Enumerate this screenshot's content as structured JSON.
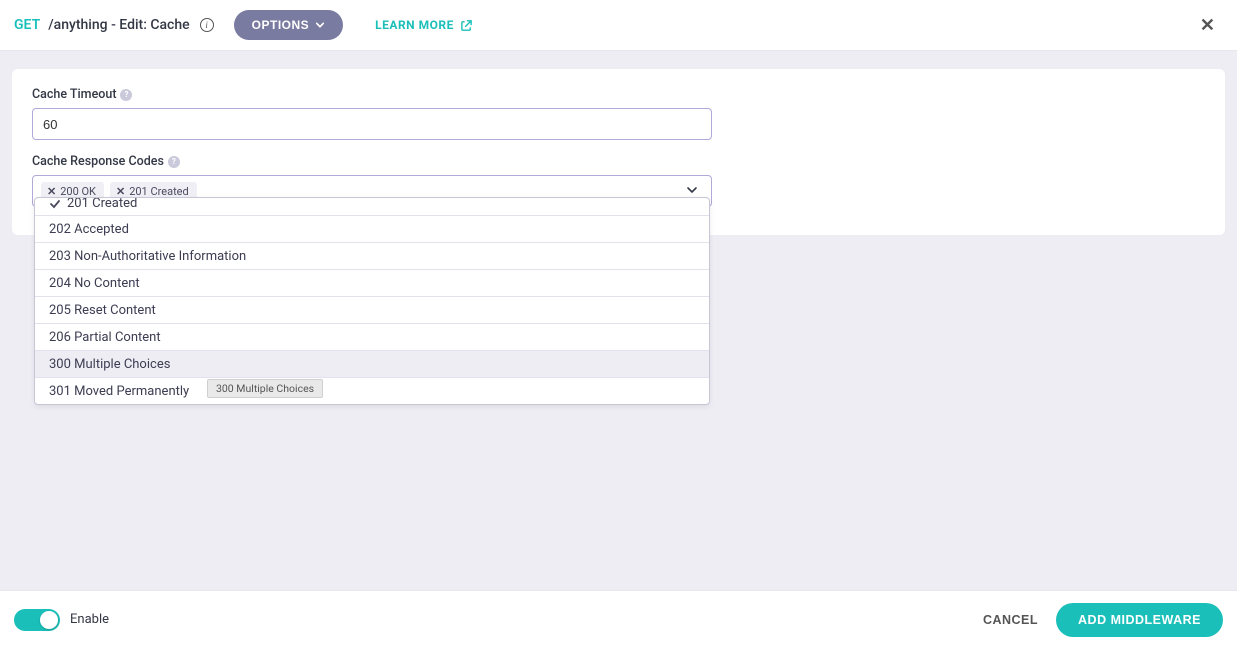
{
  "header": {
    "method": "GET",
    "title": "/anything - Edit: Cache",
    "options_label": "OPTIONS",
    "learn_more_label": "LEARN MORE"
  },
  "form": {
    "cache_timeout": {
      "label": "Cache Timeout",
      "value": "60"
    },
    "cache_response_codes": {
      "label": "Cache Response Codes",
      "selected": [
        {
          "label": "200 OK"
        },
        {
          "label": "201 Created"
        }
      ],
      "options": [
        {
          "label": "201 Created",
          "selected": true
        },
        {
          "label": "202 Accepted"
        },
        {
          "label": "203 Non-Authoritative Information"
        },
        {
          "label": "204 No Content"
        },
        {
          "label": "205 Reset Content"
        },
        {
          "label": "206 Partial Content"
        },
        {
          "label": "300 Multiple Choices",
          "highlight": true
        },
        {
          "label": "301 Moved Permanently"
        }
      ],
      "tooltip": "300 Multiple Choices"
    }
  },
  "footer": {
    "enable_label": "Enable",
    "enabled": true,
    "cancel_label": "CANCEL",
    "primary_label": "ADD MIDDLEWARE"
  }
}
